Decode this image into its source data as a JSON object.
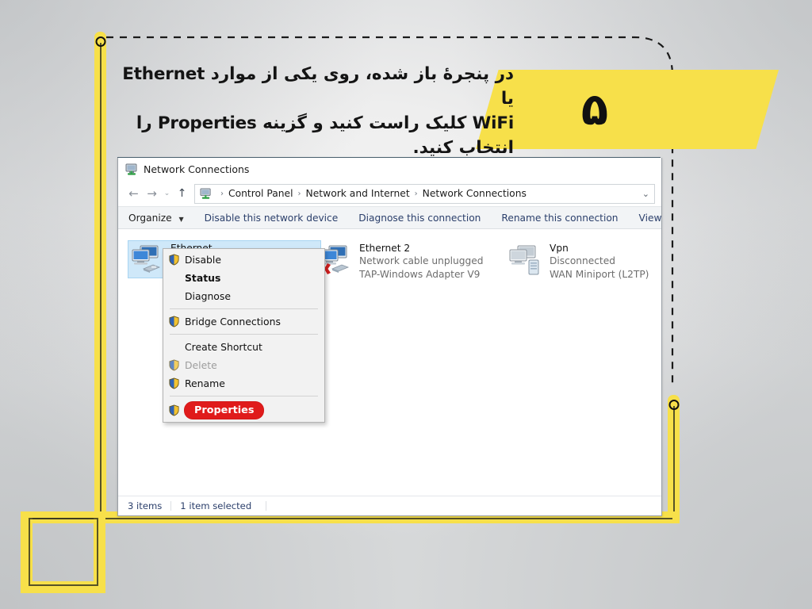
{
  "slide": {
    "step_number": "۵",
    "caption_lines": [
      "در پنجرهٔ باز شده، روی یکی از موارد Ethernet یا",
      "WiFi کلیک راست کنید و گزینه Properties را",
      "انتخاب کنید."
    ],
    "accent_color": "#F7E04A",
    "highlight_color": "#E01B1B"
  },
  "window": {
    "title": "Network Connections",
    "title_icon": "network-connections-icon",
    "nav": {
      "back_icon": "arrow-left-icon",
      "forward_icon": "arrow-right-icon",
      "recent_icon": "chevron-down-icon",
      "up_icon": "arrow-up-icon",
      "breadcrumb_icon": "network-connections-icon",
      "breadcrumbs": [
        "Control Panel",
        "Network and Internet",
        "Network Connections"
      ],
      "separator": "›",
      "dropdown_icon": "chevron-down-icon"
    },
    "toolbar": {
      "organize": "Organize",
      "organize_caret": "▼",
      "items": [
        "Disable this network device",
        "Diagnose this connection",
        "Rename this connection",
        "View status of this conn"
      ]
    },
    "connections": [
      {
        "name": "Ethernet",
        "status": "",
        "adapter": "",
        "icon": "network-adapter-icon",
        "selected": true
      },
      {
        "name": "Ethernet 2",
        "status": "Network cable unplugged",
        "adapter": "TAP-Windows Adapter V9",
        "icon": "network-adapter-unplugged-icon",
        "selected": false
      },
      {
        "name": "Vpn",
        "status": "Disconnected",
        "adapter": "WAN Miniport (L2TP)",
        "icon": "vpn-adapter-icon",
        "selected": false
      }
    ],
    "context_menu": {
      "items": [
        {
          "label": "Disable",
          "icon": "shield-icon",
          "bold": false,
          "disabled": false,
          "highlighted": false
        },
        {
          "label": "Status",
          "icon": "",
          "bold": true,
          "disabled": false,
          "highlighted": false
        },
        {
          "label": "Diagnose",
          "icon": "",
          "bold": false,
          "disabled": false,
          "highlighted": false
        },
        {
          "label": "Bridge Connections",
          "icon": "shield-icon",
          "bold": false,
          "disabled": false,
          "highlighted": false
        },
        {
          "label": "Create Shortcut",
          "icon": "",
          "bold": false,
          "disabled": false,
          "highlighted": false
        },
        {
          "label": "Delete",
          "icon": "shield-icon",
          "bold": false,
          "disabled": true,
          "highlighted": false
        },
        {
          "label": "Rename",
          "icon": "shield-icon",
          "bold": false,
          "disabled": false,
          "highlighted": false
        },
        {
          "label": "Properties",
          "icon": "shield-icon",
          "bold": false,
          "disabled": false,
          "highlighted": true
        }
      ]
    },
    "status_bar": {
      "item_count": "3 items",
      "selection": "1 item selected"
    }
  }
}
